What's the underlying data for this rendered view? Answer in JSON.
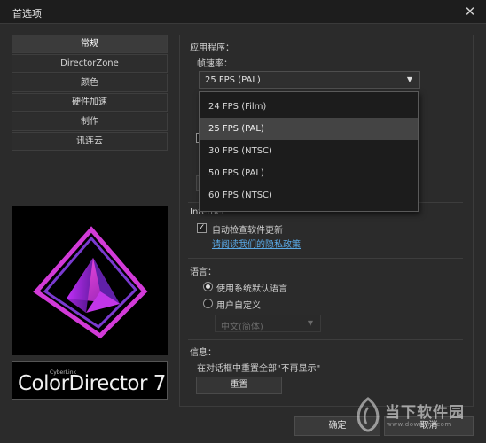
{
  "window": {
    "title": "首选项",
    "close_glyph": "✕"
  },
  "sidebar": {
    "items": [
      {
        "label": "常规",
        "active": true
      },
      {
        "label": "DirectorZone",
        "active": false
      },
      {
        "label": "颜色",
        "active": false
      },
      {
        "label": "硬件加速",
        "active": false
      },
      {
        "label": "制作",
        "active": false
      },
      {
        "label": "讯连云",
        "active": false
      }
    ]
  },
  "brand": {
    "small": "CyberLink",
    "name": "ColorDirector 7"
  },
  "app_section": {
    "heading": "应用程序：",
    "frame_rate_label": "帧速率：",
    "frame_rate_value": "25 FPS (PAL)",
    "frame_rate_options": [
      {
        "label": "24 FPS (Film)",
        "highlighted": false
      },
      {
        "label": "25 FPS (PAL)",
        "highlighted": true
      },
      {
        "label": "30 FPS (NTSC)",
        "highlighted": false
      },
      {
        "label": "50 FPS (PAL)",
        "highlighted": false
      },
      {
        "label": "60 FPS (NTSC)",
        "highlighted": false
      }
    ]
  },
  "internet": {
    "heading": "Internet",
    "auto_update_label": "自动检查软件更新",
    "auto_update_checked": true,
    "privacy_link": "请阅读我们的隐私政策"
  },
  "language": {
    "heading": "语言：",
    "system_default_label": "使用系统默认语言",
    "custom_label": "用户自定义",
    "custom_value": "中文(简体)",
    "selected": "system_default"
  },
  "info": {
    "heading": "信息：",
    "reset_text": "在对话框中重置全部\"不再显示\"",
    "reset_button": "重置"
  },
  "footer": {
    "ok_button": "确定",
    "cancel_button": "取消"
  },
  "watermark": {
    "text": "当下软件园",
    "url": "www.downxia.com"
  },
  "colors": {
    "window_bg": "#2b2b2b",
    "titlebar_bg": "#1d1d1d",
    "link": "#5aa9e6",
    "logo_magenta": "#e030d0"
  },
  "icons": {
    "close": "close-icon",
    "dropdown": "chevron-down-icon",
    "check": "check-icon",
    "logo": "colordirector-pyramid-logo"
  }
}
